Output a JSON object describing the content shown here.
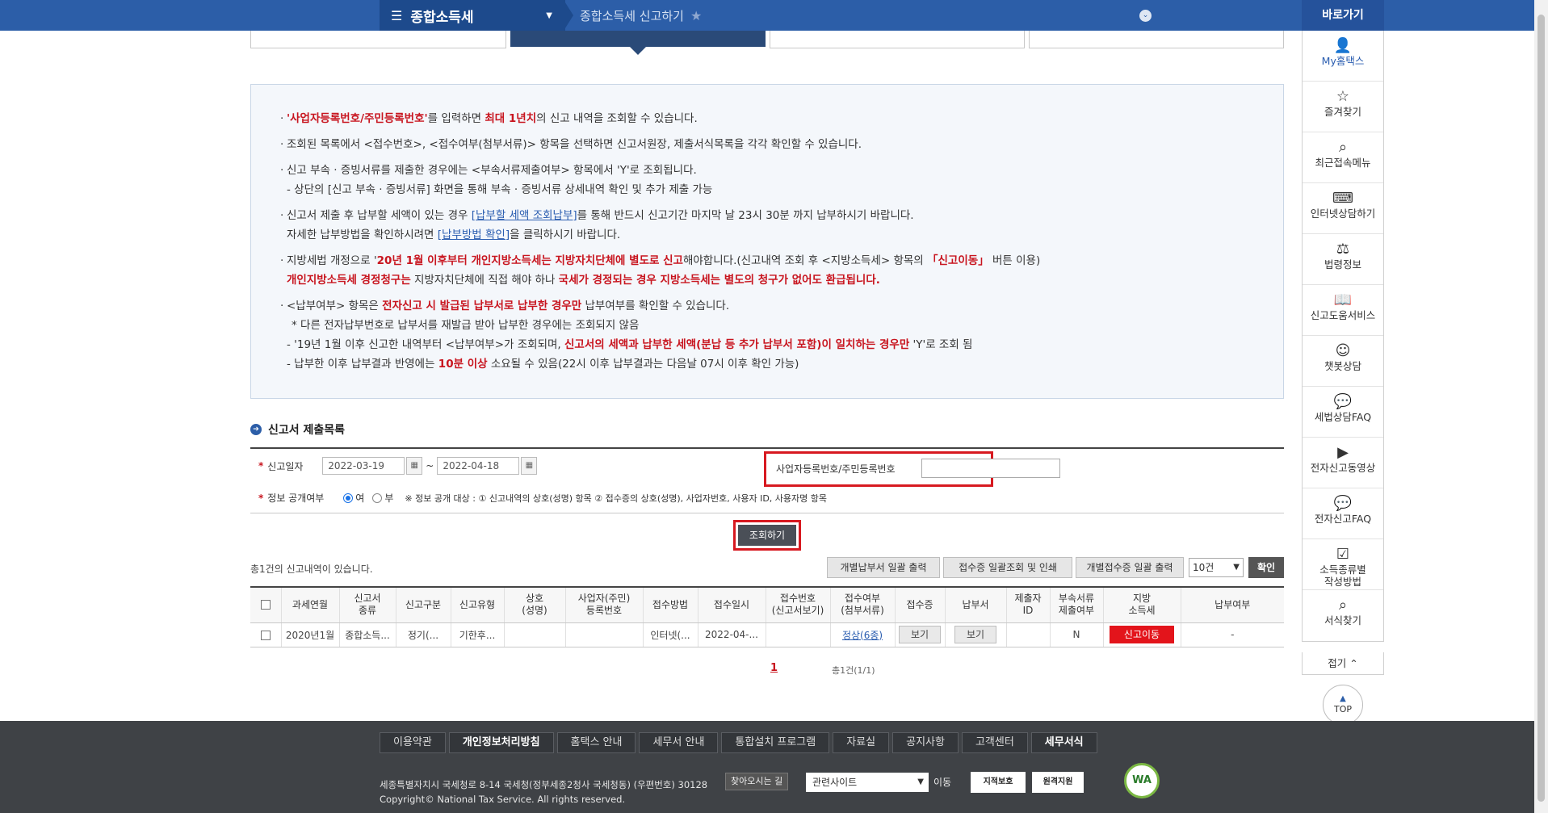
{
  "topbar": {
    "menu1_label": "종합소득세",
    "menu2_label": "종합소득세 신고하기"
  },
  "info": {
    "line1_a": "'사업자등록번호/주민등록번호'",
    "line1_b": "를 입력하면 ",
    "line1_c": "최대 1년치",
    "line1_d": "의 신고 내역을 조회할 수 있습니다.",
    "line2": "조회된 목록에서 <접수번호>, <접수여부(첨부서류)> 항목을 선택하면 신고서원장, 제출서식목록을 각각 확인할 수 있습니다.",
    "line3": "신고 부속 · 증빙서류를 제출한 경우에는 <부속서류제출여부> 항목에서 'Y'로 조회됩니다.",
    "line3_sub": "- 상단의 [신고 부속 · 증빙서류] 화면을 통해 부속 · 증빙서류 상세내역 확인 및 추가 제출 가능",
    "line4_a": "신고서 제출 후 납부할 세액이 있는 경우 ",
    "line4_link": "[납부할 세액 조회납부]",
    "line4_b": "를 통해 반드시 신고기간 마지막 날 23시 30분 까지 납부하시기 바랍니다.",
    "line4_sub_a": "자세한 납부방법을 확인하시려면 ",
    "line4_sub_link": "[납부방법 확인]",
    "line4_sub_b": "을 클릭하시기 바랍니다.",
    "line5_a": "지방세법 개정으로 '",
    "line5_b": "20년 1월 이후부터 개인지방소득세는 지방자치단체에 별도로 신고",
    "line5_c": "해야합니다.(신고내역 조회 후 <지방소득세> 항목의 ",
    "line5_d": "「신고이동」",
    "line5_e": " 버튼 이용)",
    "line5_sub_a": "개인지방소득세 경정청구는",
    "line5_sub_b": " 지방자치단체에 직접 해야 하나 ",
    "line5_sub_c": "국세가 경정되는 경우 지방소득세는 별도의 청구가 없어도 환급됩니다.",
    "line6_a": "<납부여부> 항목은 ",
    "line6_b": "전자신고 시 발급된 납부서로 납부한 경우만",
    "line6_c": " 납부여부를 확인할 수 있습니다.",
    "line6_sub1": "* 다른 전자납부번호로 납부서를 재발급 받아 납부한 경우에는 조회되지 않음",
    "line6_sub2_a": "- '19년 1월 이후 신고한 내역부터 <납부여부>가 조회되며, ",
    "line6_sub2_b": "신고서의 세액과 납부한 세액(분납 등 추가 납부서 포함)이 일치하는 경우만",
    "line6_sub2_c": " 'Y'로 조회 됨",
    "line6_sub3_a": "- 납부한 이후 납부결과 반영에는 ",
    "line6_sub3_b": "10분 이상",
    "line6_sub3_c": " 소요될 수 있음(22시 이후 납부결과는 다음날 07시 이후 확인 가능)"
  },
  "section_title": "신고서 제출목록",
  "form": {
    "date_label": "신고일자",
    "date_from": "2022-03-19",
    "date_tilde": "~",
    "date_to": "2022-04-18",
    "bizno_label": "사업자등록번호/주민등록번호",
    "bizno_value": "",
    "public_label": "정보 공개여부",
    "radio_yes": "여",
    "radio_no": "부",
    "public_note": "※ 정보 공개 대상 : ① 신고내역의 상호(성명) 항목 ② 접수증의 상호(성명), 사업자번호, 사용자 ID, 사용자명 항목",
    "search_button": "조회하기"
  },
  "result": {
    "count_text": "총1건의 신고내역이 있습니다.",
    "btn1": "개별납부서 일괄 출력",
    "btn2": "접수증 일괄조회 및 인쇄",
    "btn3": "개별접수증 일괄 출력",
    "page_size": "10건",
    "ok": "확인"
  },
  "table": {
    "headers": [
      "과세연월",
      "신고서\n종류",
      "신고구분",
      "신고유형",
      "상호\n(성명)",
      "사업자(주민)\n등록번호",
      "접수방법",
      "접수일시",
      "접수번호\n(신고서보기)",
      "접수여부\n(첨부서류)",
      "접수증",
      "납부서",
      "제출자\nID",
      "부속서류\n제출여부",
      "지방\n소득세",
      "납부여부"
    ],
    "rows": [
      {
        "period": "2020년1월",
        "type": "종합소득...",
        "kind": "정기(...",
        "method_type": "기한후...",
        "name": "",
        "regno": "",
        "channel": "인터넷(...",
        "datetime": "2022-04-...",
        "receipt_no": "",
        "status": "정상(6종)",
        "receipt_btn": "보기",
        "bill_btn": "보기",
        "submitter": "",
        "attach": "N",
        "local_btn": "신고이동",
        "paid": "-"
      }
    ]
  },
  "pager": {
    "current": "1",
    "total": "총1건(1/1)"
  },
  "quick": {
    "title": "바로가기",
    "items": [
      "My홈택스",
      "즐겨찾기",
      "최근접속메뉴",
      "인터넷상담하기",
      "법령정보",
      "신고도움서비스",
      "챗봇상담",
      "세법상담FAQ",
      "전자신고동영상",
      "전자신고FAQ",
      "소득종류별\n작성방법",
      "서식찾기"
    ],
    "fold": "접기 ⌃",
    "top": "TOP"
  },
  "footer": {
    "nav": [
      "이용약관",
      "개인정보처리방침",
      "홈택스 안내",
      "세무서 안내",
      "통합설치 프로그램",
      "자료실",
      "공지사항",
      "고객센터",
      "세무서식"
    ],
    "address": "세종특별자치시 국세청로 8-14 국세청(정부세종2청사 국세청동) (우편번호) 30128",
    "directions": "찾아오시는 길",
    "copyright": "Copyright© National Tax Service. All rights reserved.",
    "related": "관련사이트",
    "move": "이동",
    "logo1": "지적보호",
    "logo2": "원격지원",
    "wa": "WA"
  }
}
